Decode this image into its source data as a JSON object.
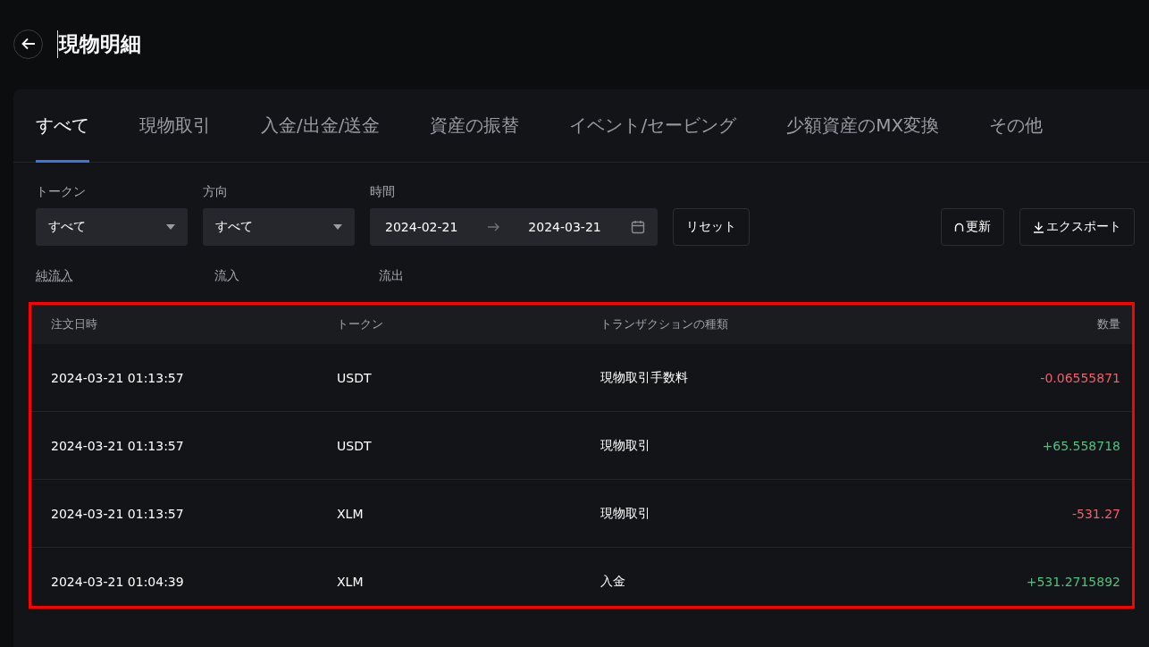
{
  "page": {
    "title": "現物明細"
  },
  "tabs": [
    {
      "label": "すべて",
      "selected": true
    },
    {
      "label": "現物取引",
      "selected": false
    },
    {
      "label": "入金/出金/送金",
      "selected": false
    },
    {
      "label": "資産の振替",
      "selected": false
    },
    {
      "label": "イベント/セービング",
      "selected": false
    },
    {
      "label": "少額資産のMX変換",
      "selected": false
    },
    {
      "label": "その他",
      "selected": false
    }
  ],
  "filters": {
    "token": {
      "label": "トークン",
      "value": "すべて"
    },
    "direction": {
      "label": "方向",
      "value": "すべて"
    },
    "time": {
      "label": "時間",
      "start": "2024-02-21",
      "end": "2024-03-21"
    },
    "reset_button": "リセット",
    "refresh_button": "更新",
    "export_button": "エクスポート"
  },
  "summary": [
    "純流入",
    "流入",
    "流出"
  ],
  "table": {
    "columns": [
      "注文日時",
      "トークン",
      "トランザクションの種類",
      "数量"
    ],
    "rows": [
      {
        "time": "2024-03-21 01:13:57",
        "token": "USDT",
        "type": "現物取引手数料",
        "amount": "-0.06555871",
        "kind": "negative"
      },
      {
        "time": "2024-03-21 01:13:57",
        "token": "USDT",
        "type": "現物取引",
        "amount": "+65.558718",
        "kind": "positive"
      },
      {
        "time": "2024-03-21 01:13:57",
        "token": "XLM",
        "type": "現物取引",
        "amount": "-531.27",
        "kind": "negative"
      },
      {
        "time": "2024-03-21 01:04:39",
        "token": "XLM",
        "type": "入金",
        "amount": "+531.2715892",
        "kind": "positive"
      }
    ]
  }
}
